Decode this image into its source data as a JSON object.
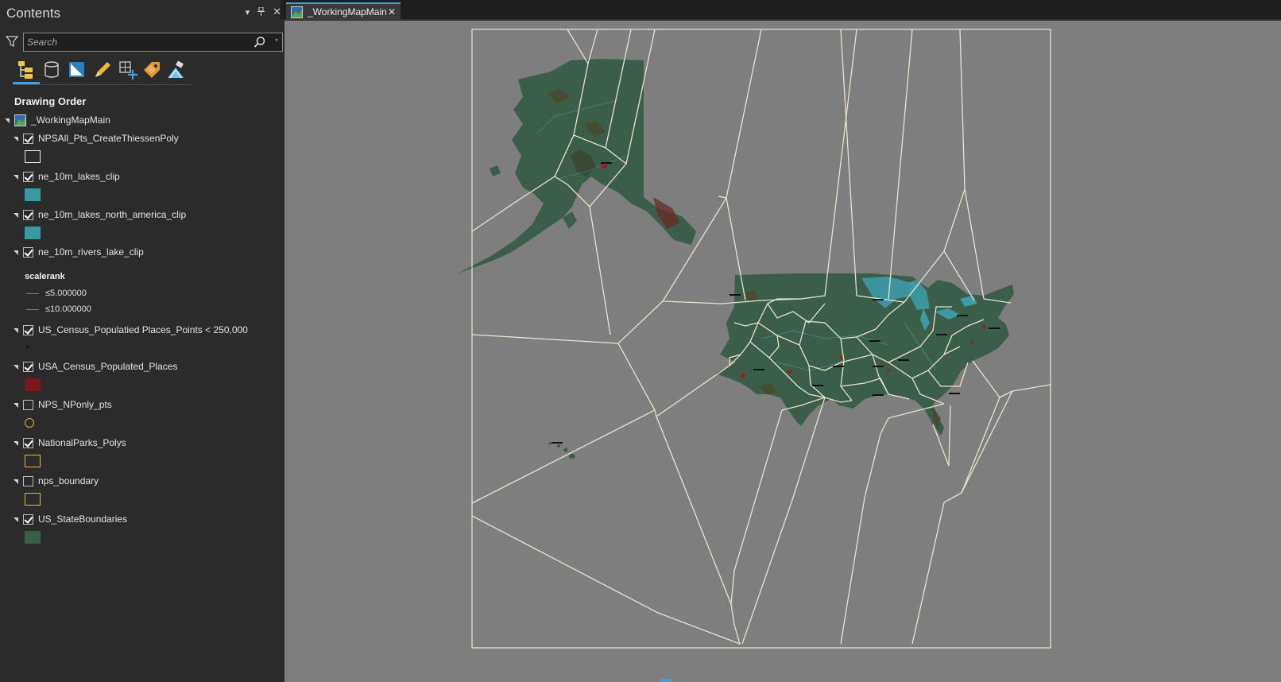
{
  "contents": {
    "title": "Contents",
    "controls": {
      "menu": "▾",
      "pin": "📌",
      "close": "✕"
    },
    "search": {
      "placeholder": "Search"
    },
    "section_title": "Drawing Order",
    "map_name": "_WorkingMapMain",
    "layers": [
      {
        "name": "NPSAll_Pts_CreateThiessenPoly",
        "checked": true,
        "symbol": "outline-white"
      },
      {
        "name": "ne_10m_lakes_clip",
        "checked": true,
        "symbol": "fill",
        "color": "#3a9aa1"
      },
      {
        "name": "ne_10m_lakes_north_america_clip",
        "checked": true,
        "symbol": "fill",
        "color": "#3a9aa1"
      },
      {
        "name": "ne_10m_rivers_lake_clip",
        "checked": true,
        "symbol": "graduated-lines",
        "field": "scalerank",
        "classes": [
          {
            "label": "≤5.000000"
          },
          {
            "label": "≤10.000000"
          }
        ]
      },
      {
        "name": "US_Census_Populatied Places_Points < 250,000",
        "checked": true,
        "symbol": "dot"
      },
      {
        "name": "USA_Census_Populated_Places",
        "checked": true,
        "symbol": "fill",
        "color": "#7a1a1a"
      },
      {
        "name": "NPS_NPonly_pts",
        "checked": false,
        "symbol": "circle-yellow"
      },
      {
        "name": "NationalParks_Polys",
        "checked": true,
        "symbol": "outline-yellow"
      },
      {
        "name": "nps_boundary",
        "checked": false,
        "symbol": "outline-yellow"
      },
      {
        "name": "US_StateBoundaries",
        "checked": true,
        "symbol": "fill",
        "color": "#3b5e4a"
      }
    ]
  },
  "map_tab": {
    "label": "_WorkingMapMain"
  },
  "colors": {
    "accent": "#3ea0e6",
    "land": "#3b5e4a",
    "water": "#3a9aa1",
    "thiessen_lines": "#e9e2cc",
    "map_background": "#7e7e7e"
  }
}
